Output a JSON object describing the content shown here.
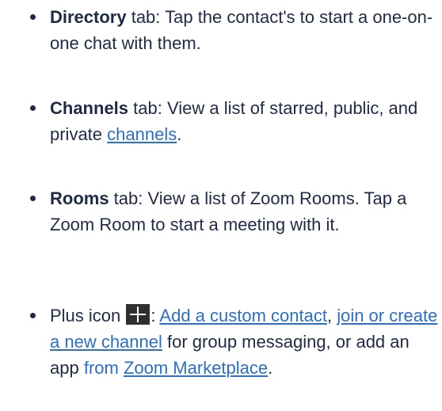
{
  "items": [
    {
      "term": "Directory",
      "rest": " tab: Tap the contact's to start a one-on-one chat with them."
    },
    {
      "term": "Channels",
      "rest": " tab: View a list of starred, public, and private ",
      "link": "channels",
      "end": "."
    },
    {
      "term": "Rooms",
      "rest": " tab: View a list of Zoom Rooms. Tap a Zoom Room to start a meeting with it."
    },
    {
      "lead": "Plus icon ",
      "icon": "plus-icon",
      "colon": ": ",
      "link1": "Add a custom contact",
      "sep": ", ",
      "link2": "join or create a new channel",
      "mid": " for group messaging, or add an app ",
      "from": "from",
      "space": " ",
      "link3": "Zoom Marketplace",
      "end": "."
    }
  ],
  "colors": {
    "text": "#1f2a44",
    "link": "#2a6fc9"
  }
}
